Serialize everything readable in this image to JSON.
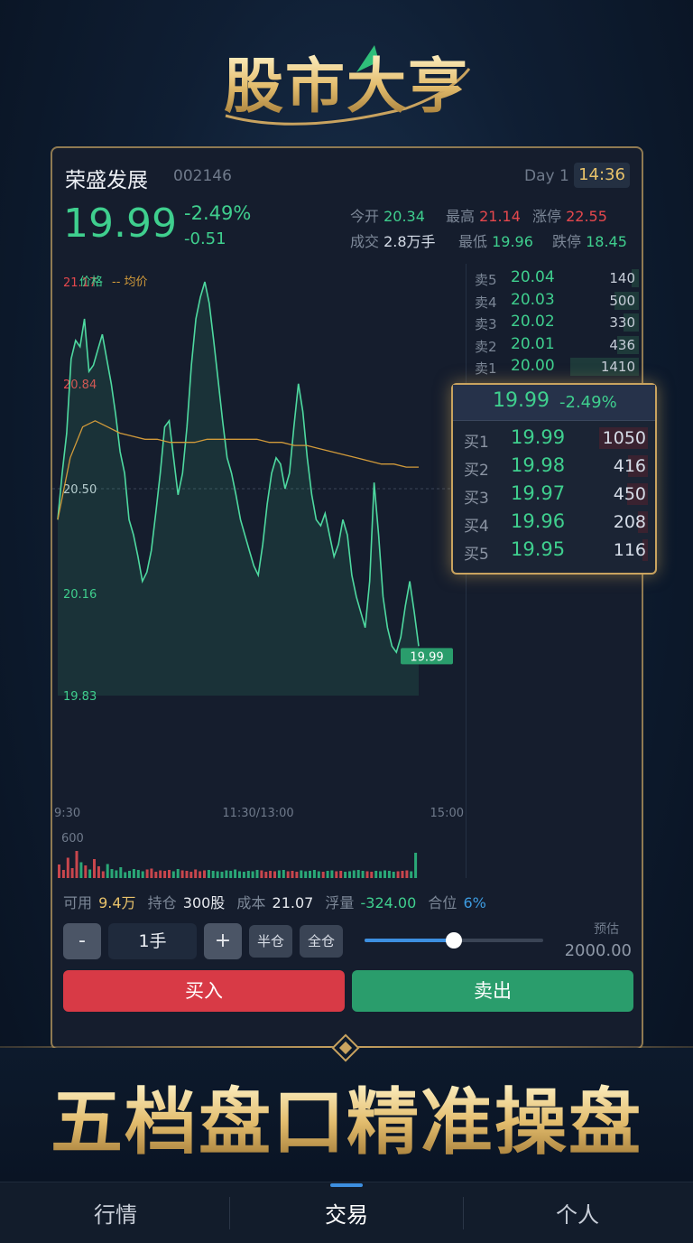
{
  "app": {
    "title": "股市大亨"
  },
  "colors": {
    "up": "#e5484d",
    "down": "#3fcf8e",
    "gold": "#c9a35f",
    "accent": "#3d8fe0",
    "avg_line": "#d19a3a"
  },
  "stock": {
    "name": "荣盛发展",
    "code": "002146",
    "day": "Day 1",
    "time": "14:36",
    "price": "19.99",
    "pct": "-2.49%",
    "change": "-0.51"
  },
  "stats": {
    "open_label": "今开",
    "open": "20.34",
    "high_label": "最高",
    "high": "21.14",
    "limit_up_label": "涨停",
    "limit_up": "22.55",
    "volume_label": "成交",
    "volume": "2.8万手",
    "low_label": "最低",
    "low": "19.96",
    "limit_down_label": "跌停",
    "limit_down": "18.45"
  },
  "chart": {
    "legend_price": "价格",
    "legend_avg": "-- 均价",
    "y_labels": [
      "21.17",
      "20.84",
      "20.50",
      "20.16",
      "19.83"
    ],
    "x_labels": [
      "9:30",
      "11:30/13:00",
      "15:00"
    ],
    "last_price_tag": "19.99",
    "volume_axis_label": "600"
  },
  "chart_data": {
    "type": "line",
    "ylim": [
      19.83,
      21.17
    ],
    "baseline": 20.5,
    "x_ticks": [
      "9:30",
      "11:30/13:00",
      "15:00"
    ],
    "series": [
      {
        "name": "价格",
        "values": [
          20.4,
          20.55,
          20.68,
          20.92,
          20.98,
          20.96,
          21.05,
          20.88,
          20.9,
          20.95,
          21.0,
          20.92,
          20.84,
          20.74,
          20.62,
          20.55,
          20.4,
          20.35,
          20.28,
          20.2,
          20.23,
          20.3,
          20.42,
          20.55,
          20.7,
          20.72,
          20.6,
          20.48,
          20.55,
          20.7,
          20.9,
          21.05,
          21.12,
          21.17,
          21.1,
          20.98,
          20.85,
          20.72,
          20.6,
          20.55,
          20.48,
          20.4,
          20.35,
          20.3,
          20.25,
          20.22,
          20.32,
          20.45,
          20.55,
          20.6,
          20.58,
          20.5,
          20.55,
          20.7,
          20.84,
          20.75,
          20.6,
          20.48,
          20.4,
          20.38,
          20.42,
          20.35,
          20.28,
          20.32,
          20.4,
          20.35,
          20.22,
          20.15,
          20.1,
          20.05,
          20.2,
          20.52,
          20.35,
          20.15,
          20.05,
          19.99,
          19.97,
          20.02,
          20.12,
          20.2,
          20.1,
          19.99
        ]
      },
      {
        "name": "均价",
        "values": [
          20.4,
          20.6,
          20.7,
          20.72,
          20.7,
          20.68,
          20.67,
          20.66,
          20.66,
          20.65,
          20.65,
          20.65,
          20.66,
          20.66,
          20.66,
          20.66,
          20.66,
          20.65,
          20.65,
          20.64,
          20.64,
          20.63,
          20.62,
          20.61,
          20.6,
          20.59,
          20.58,
          20.58,
          20.57,
          20.57
        ]
      }
    ],
    "volume_series": [
      300,
      180,
      450,
      220,
      600,
      350,
      280,
      190,
      420,
      260,
      150,
      310,
      200,
      170,
      240,
      130,
      160,
      200,
      180,
      150,
      190,
      210,
      140,
      170,
      160,
      180,
      150,
      200,
      170,
      160,
      140,
      190,
      150,
      170,
      180,
      160,
      150,
      140,
      170,
      160,
      190,
      150,
      140,
      160,
      150,
      180,
      170,
      140,
      160,
      150,
      170,
      180,
      150,
      160,
      140,
      170,
      150,
      160,
      180,
      150,
      140,
      160,
      170,
      150,
      160,
      140,
      150,
      170,
      180,
      160,
      150,
      140,
      160,
      150,
      170,
      160,
      140,
      150,
      160,
      170,
      150,
      560
    ]
  },
  "order_book": {
    "asks": [
      {
        "label": "卖5",
        "price": "20.04",
        "vol": "140",
        "frac": 0.1
      },
      {
        "label": "卖4",
        "price": "20.03",
        "vol": "500",
        "frac": 0.35
      },
      {
        "label": "卖3",
        "price": "20.02",
        "vol": "330",
        "frac": 0.23
      },
      {
        "label": "卖2",
        "price": "20.01",
        "vol": "436",
        "frac": 0.31
      },
      {
        "label": "卖1",
        "price": "20.00",
        "vol": "1410",
        "frac": 1.0
      }
    ],
    "bid_header_price": "19.99",
    "bid_header_pct": "-2.49%",
    "bids": [
      {
        "label": "买1",
        "price": "19.99",
        "vol": "1050",
        "frac": 0.75
      },
      {
        "label": "买2",
        "price": "19.98",
        "vol": "416",
        "frac": 0.3
      },
      {
        "label": "买3",
        "price": "19.97",
        "vol": "450",
        "frac": 0.32
      },
      {
        "label": "买4",
        "price": "19.96",
        "vol": "208",
        "frac": 0.15
      },
      {
        "label": "买5",
        "price": "19.95",
        "vol": "116",
        "frac": 0.08
      }
    ]
  },
  "position": {
    "available_label": "可用",
    "available": "9.4万",
    "holding_label": "持仓",
    "holding": "300股",
    "cost_label": "成本",
    "cost": "21.07",
    "float_label": "浮量",
    "float": "-324.00",
    "ratio_label": "合位",
    "ratio": "6%"
  },
  "trade": {
    "minus": "-",
    "plus": "+",
    "quantity": "1手",
    "half_label": "半仓",
    "full_label": "全仓",
    "slider_value": 0.5,
    "estimate_label": "预估",
    "estimate_value": "2000.00",
    "buy_label": "买入",
    "sell_label": "卖出"
  },
  "slogan": "五档盘口精准操盘",
  "tabs": [
    {
      "label": "行情"
    },
    {
      "label": "交易"
    },
    {
      "label": "个人"
    }
  ],
  "active_tab": 1
}
